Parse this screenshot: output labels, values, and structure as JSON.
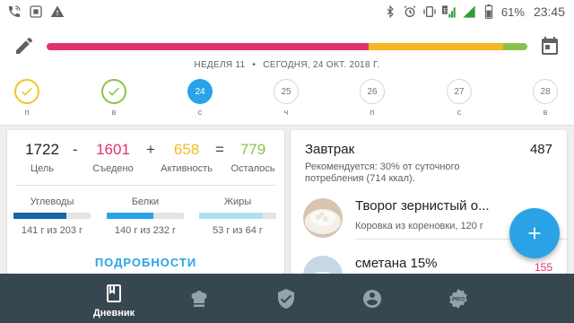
{
  "status_bar": {
    "left_icons": [
      "phone-wifi-icon",
      "screen-icon",
      "warning-icon"
    ],
    "right_icons": [
      "bluetooth-icon",
      "alarm-icon",
      "vibrate-icon",
      "signal-e-icon",
      "signal-icon"
    ],
    "battery": "61%",
    "time": "23:45"
  },
  "header": {
    "edit_icon": "pencil-icon",
    "calendar_icon": "calendar-icon",
    "progress_segments": [
      {
        "name": "eaten",
        "fraction": 0.67,
        "color": "#e0336e"
      },
      {
        "name": "activity",
        "fraction": 0.28,
        "color": "#f5b823"
      },
      {
        "name": "remaining",
        "fraction": 0.05,
        "color": "#8bc34a"
      }
    ],
    "week": "НЕДЕЛЯ 11",
    "today": "СЕГОДНЯ, 24 ОКТ. 2018 Г.",
    "days": [
      {
        "num": "",
        "label": "п",
        "state": "done-y"
      },
      {
        "num": "",
        "label": "в",
        "state": "done-g"
      },
      {
        "num": "24",
        "label": "с",
        "state": "today"
      },
      {
        "num": "25",
        "label": "ч",
        "state": "future"
      },
      {
        "num": "26",
        "label": "п",
        "state": "future"
      },
      {
        "num": "27",
        "label": "с",
        "state": "future"
      },
      {
        "num": "28",
        "label": "в",
        "state": "future"
      }
    ]
  },
  "summary": {
    "goal": {
      "value": "1722",
      "label": "Цель"
    },
    "eaten": {
      "value": "1601",
      "label": "Съедено",
      "color": "#e0336e"
    },
    "activity": {
      "value": "658",
      "label": "Активность",
      "color": "#f5b823"
    },
    "left": {
      "value": "779",
      "label": "Осталось",
      "color": "#8bc34a"
    },
    "ops": [
      "-",
      "+",
      "="
    ],
    "macros": [
      {
        "name": "Углеводы",
        "value": "141 г из 203 г",
        "fraction": 0.69,
        "color": "#1565a8"
      },
      {
        "name": "Белки",
        "value": "140 г из 232 г",
        "fraction": 0.6,
        "color": "#29a3e6"
      },
      {
        "name": "Жиры",
        "value": "53 г из 64 г",
        "fraction": 0.83,
        "color": "#aee0f5"
      }
    ],
    "details_label": "ПОДРОБНОСТИ"
  },
  "meal": {
    "title": "Завтрак",
    "total": "487",
    "recommendation": "Рекомендуется: 30% от суточного потребления (714 ккал).",
    "foods": [
      {
        "name": "Творог зернистый о...",
        "sub": "Коровка из кореновки, 120 г",
        "kcal": ""
      },
      {
        "name": "сметана 15%",
        "sub": "",
        "kcal": "155"
      }
    ]
  },
  "fab_icon": "plus-icon",
  "nav": {
    "items": [
      {
        "icon": "diary-icon",
        "label": "Дневник",
        "active": true
      },
      {
        "icon": "chef-hat-icon",
        "label": "",
        "active": false
      },
      {
        "icon": "shield-check-icon",
        "label": "",
        "active": false
      },
      {
        "icon": "account-icon",
        "label": "",
        "active": false
      },
      {
        "icon": "pro-icon",
        "label": "",
        "active": false
      }
    ]
  }
}
